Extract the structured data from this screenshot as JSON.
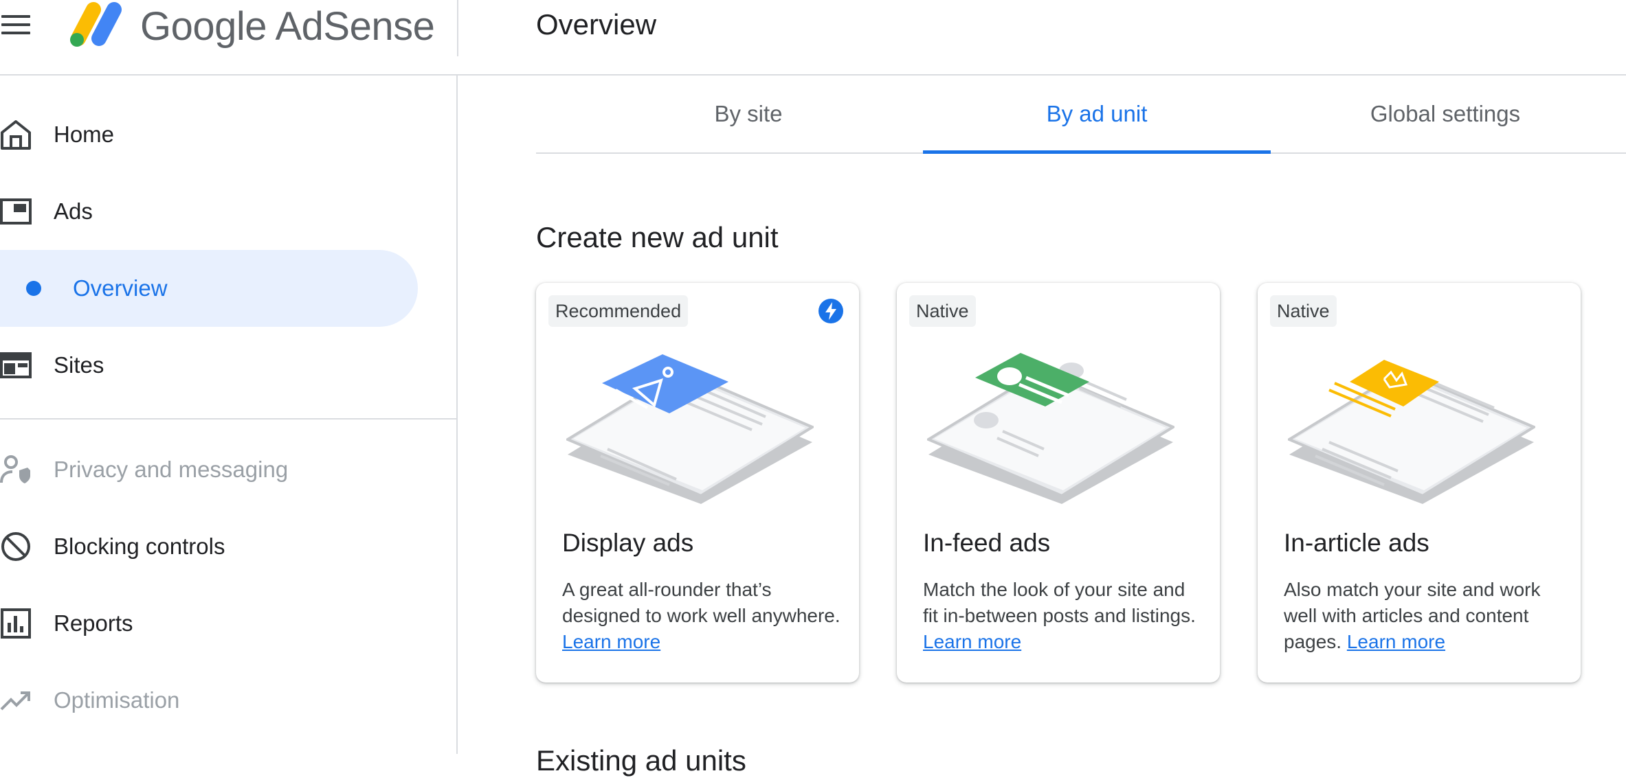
{
  "header": {
    "brand": "Google AdSense",
    "page_title": "Overview"
  },
  "sidebar": {
    "items": [
      {
        "label": "Home",
        "icon": "home-icon"
      },
      {
        "label": "Ads",
        "icon": "ads-icon"
      },
      {
        "label": "Overview",
        "icon": "dot-indicator",
        "active": true
      },
      {
        "label": "Sites",
        "icon": "sites-icon"
      },
      {
        "label": "Privacy and messaging",
        "icon": "privacy-icon",
        "disabled": true
      },
      {
        "label": "Blocking controls",
        "icon": "block-icon"
      },
      {
        "label": "Reports",
        "icon": "reports-icon"
      },
      {
        "label": "Optimisation",
        "icon": "trending-icon",
        "disabled": true
      }
    ]
  },
  "tabs": [
    {
      "label": "By site"
    },
    {
      "label": "By ad unit",
      "active": true
    },
    {
      "label": "Global settings"
    }
  ],
  "section": {
    "title": "Create new ad unit",
    "next_title_partial": "Existing ad units"
  },
  "cards": [
    {
      "badge": "Recommended",
      "title": "Display ads",
      "desc": "A great all-rounder that’s designed to work well anywhere.",
      "link": "Learn more",
      "accent": "#5b95f5"
    },
    {
      "badge": "Native",
      "title": "In-feed ads",
      "desc": "Match the look of your site and fit in-between posts and listings.",
      "link": "Learn more",
      "accent": "#4caf68"
    },
    {
      "badge": "Native",
      "title": "In-article ads",
      "desc": "Also match your site and work well with articles and content pages.",
      "link": "Learn more",
      "accent": "#fbbc04"
    }
  ],
  "colors": {
    "primary": "#1a73e8",
    "active_bg": "#e8f0fe",
    "divider": "#dadce0"
  }
}
